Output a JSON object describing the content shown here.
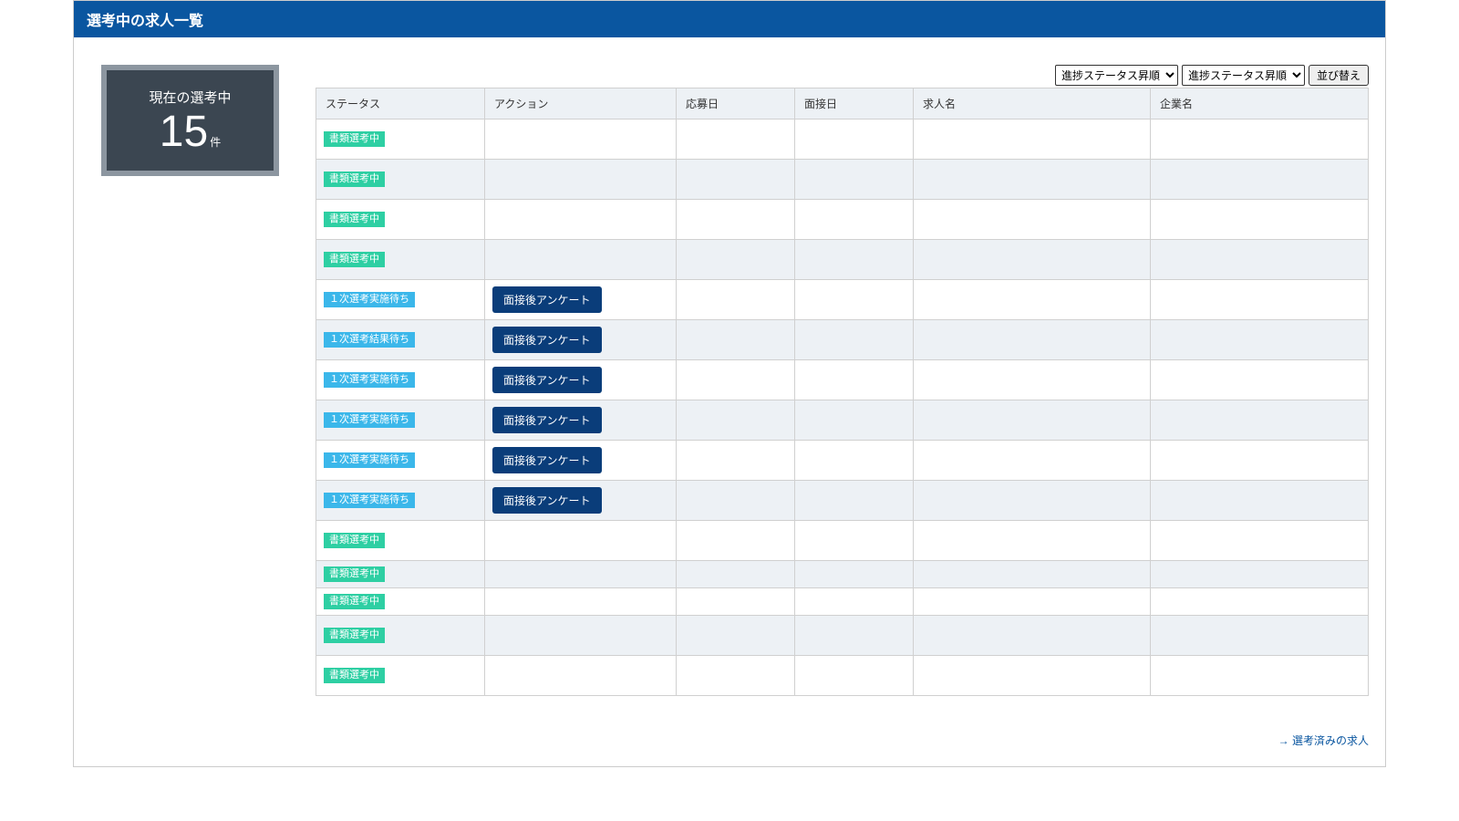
{
  "header": {
    "title": "選考中の求人一覧"
  },
  "counter": {
    "label": "現在の選考中",
    "value": "15",
    "suffix": "件"
  },
  "controls": {
    "sort1": {
      "selected": "進捗ステータス昇順"
    },
    "sort2": {
      "selected": "進捗ステータス昇順"
    },
    "button": "並び替え"
  },
  "columns": {
    "status": "ステータス",
    "action": "アクション",
    "apply_date": "応募日",
    "interview_date": "面接日",
    "job_name": "求人名",
    "company": "企業名"
  },
  "rows": [
    {
      "status": "書類選考中",
      "status_style": "green",
      "action": ""
    },
    {
      "status": "書類選考中",
      "status_style": "green",
      "action": ""
    },
    {
      "status": "書類選考中",
      "status_style": "green",
      "action": ""
    },
    {
      "status": "書類選考中",
      "status_style": "green",
      "action": ""
    },
    {
      "status": "１次選考実施待ち",
      "status_style": "blue",
      "action": "面接後アンケート"
    },
    {
      "status": "１次選考結果待ち",
      "status_style": "blue",
      "action": "面接後アンケート"
    },
    {
      "status": "１次選考実施待ち",
      "status_style": "blue",
      "action": "面接後アンケート"
    },
    {
      "status": "１次選考実施待ち",
      "status_style": "blue",
      "action": "面接後アンケート"
    },
    {
      "status": "１次選考実施待ち",
      "status_style": "blue",
      "action": "面接後アンケート"
    },
    {
      "status": "１次選考実施待ち",
      "status_style": "blue",
      "action": "面接後アンケート"
    },
    {
      "status": "書類選考中",
      "status_style": "green",
      "action": ""
    },
    {
      "status": "書類選考中",
      "status_style": "green",
      "action": "",
      "compact": true
    },
    {
      "status": "書類選考中",
      "status_style": "green",
      "action": "",
      "compact": true
    },
    {
      "status": "書類選考中",
      "status_style": "green",
      "action": ""
    },
    {
      "status": "書類選考中",
      "status_style": "green",
      "action": ""
    }
  ],
  "footer": {
    "link": "→ 選考済みの求人"
  }
}
